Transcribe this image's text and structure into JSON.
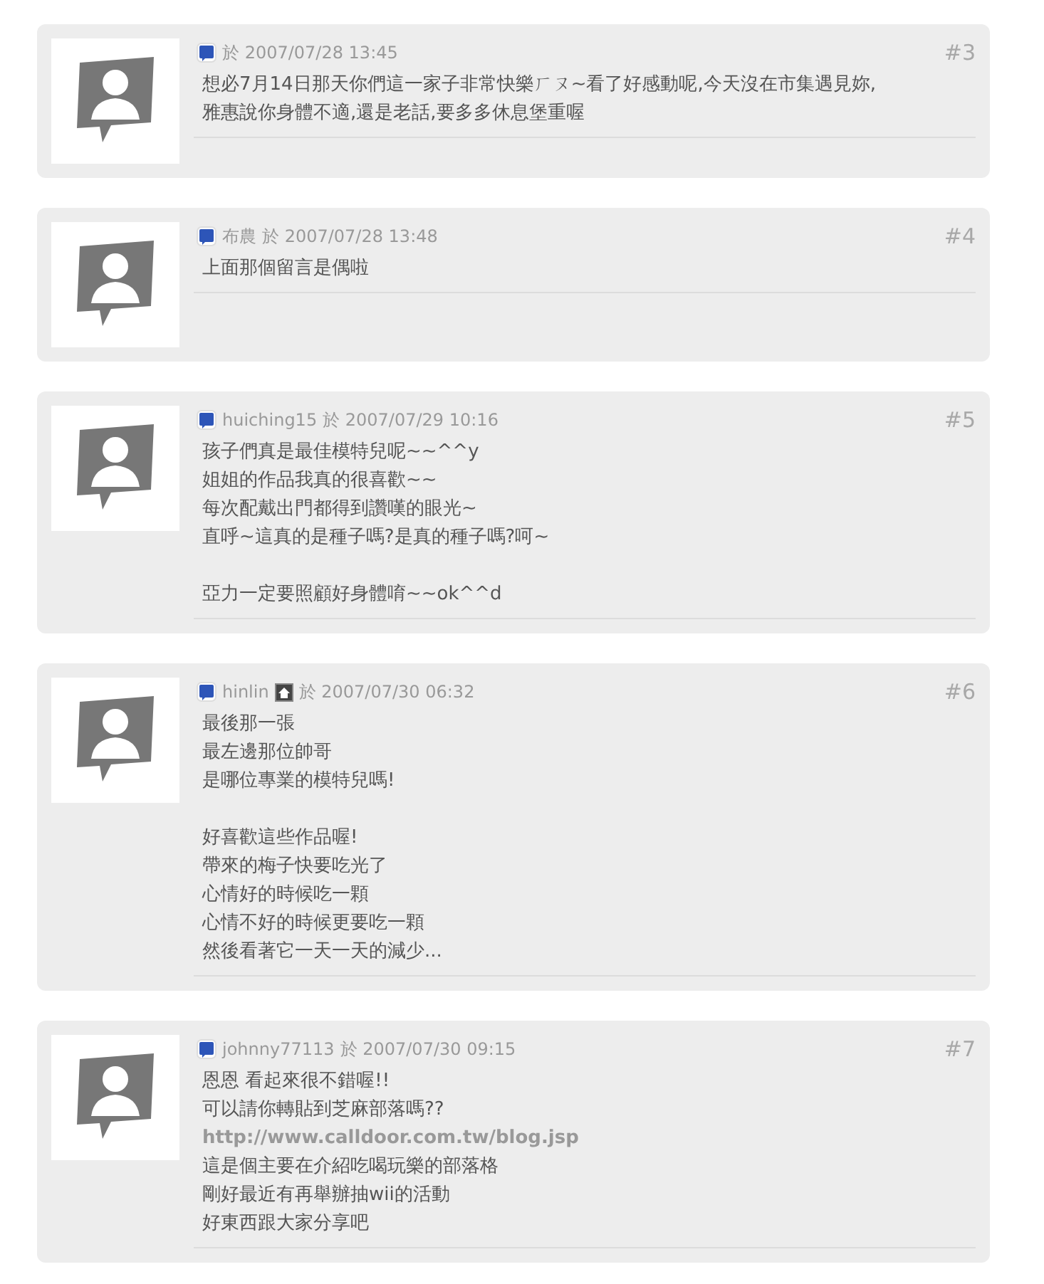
{
  "comments": [
    {
      "homepage": false,
      "time": "於 2007/07/28 13:45",
      "number": "#3",
      "paragraphs": [
        [
          {
            "kind": "text",
            "text": "想必7月14日那天你們這一家子非常快樂ㄏㄡ~看了好感動呢,今天沒在市集遇見妳,"
          },
          {
            "kind": "text",
            "text": "雅惠說你身體不適,還是老話,要多多休息堡重喔"
          }
        ]
      ]
    },
    {
      "author": "布農",
      "homepage": false,
      "time": "於 2007/07/28 13:48",
      "number": "#4",
      "paragraphs": [
        [
          {
            "kind": "text",
            "text": "上面那個留言是偶啦"
          }
        ]
      ]
    },
    {
      "author": "huiching15",
      "homepage": false,
      "time": "於 2007/07/29 10:16",
      "number": "#5",
      "paragraphs": [
        [
          {
            "kind": "text",
            "text": "孩子們真是最佳模特兒呢~~^^y"
          },
          {
            "kind": "text",
            "text": "姐姐的作品我真的很喜歡~~"
          },
          {
            "kind": "text",
            "text": "每次配戴出門都得到讚嘆的眼光~"
          },
          {
            "kind": "text",
            "text": "直呼~這真的是種子嗎?是真的種子嗎?呵~"
          }
        ],
        [
          {
            "kind": "text",
            "text": "亞力一定要照顧好身體唷~~ok^^d"
          }
        ]
      ]
    },
    {
      "author": "hinlin",
      "homepage": true,
      "time": "於 2007/07/30 06:32",
      "number": "#6",
      "paragraphs": [
        [
          {
            "kind": "text",
            "text": "最後那一張"
          },
          {
            "kind": "text",
            "text": "最左邊那位帥哥"
          },
          {
            "kind": "text",
            "text": "是哪位專業的模特兒嗎!"
          }
        ],
        [
          {
            "kind": "text",
            "text": "好喜歡這些作品喔!"
          },
          {
            "kind": "text",
            "text": "帶來的梅子快要吃光了"
          },
          {
            "kind": "text",
            "text": "心情好的時候吃一顆"
          },
          {
            "kind": "text",
            "text": "心情不好的時候更要吃一顆"
          },
          {
            "kind": "text",
            "text": "然後看著它一天一天的減少..."
          }
        ]
      ]
    },
    {
      "author": "johnny77113",
      "homepage": false,
      "time": "於 2007/07/30 09:15",
      "number": "#7",
      "paragraphs": [
        [
          {
            "kind": "text",
            "text": "恩恩 看起來很不錯喔!!"
          },
          {
            "kind": "text",
            "text": "可以請你轉貼到芝麻部落嗎??"
          },
          {
            "kind": "link",
            "text": "http://www.calldoor.com.tw/blog.jsp"
          },
          {
            "kind": "text",
            "text": "這是個主要在介紹吃喝玩樂的部落格"
          },
          {
            "kind": "text",
            "text": "剛好最近有再舉辦抽wii的活動"
          },
          {
            "kind": "text",
            "text": "好東西跟大家分享吧"
          }
        ]
      ]
    }
  ]
}
